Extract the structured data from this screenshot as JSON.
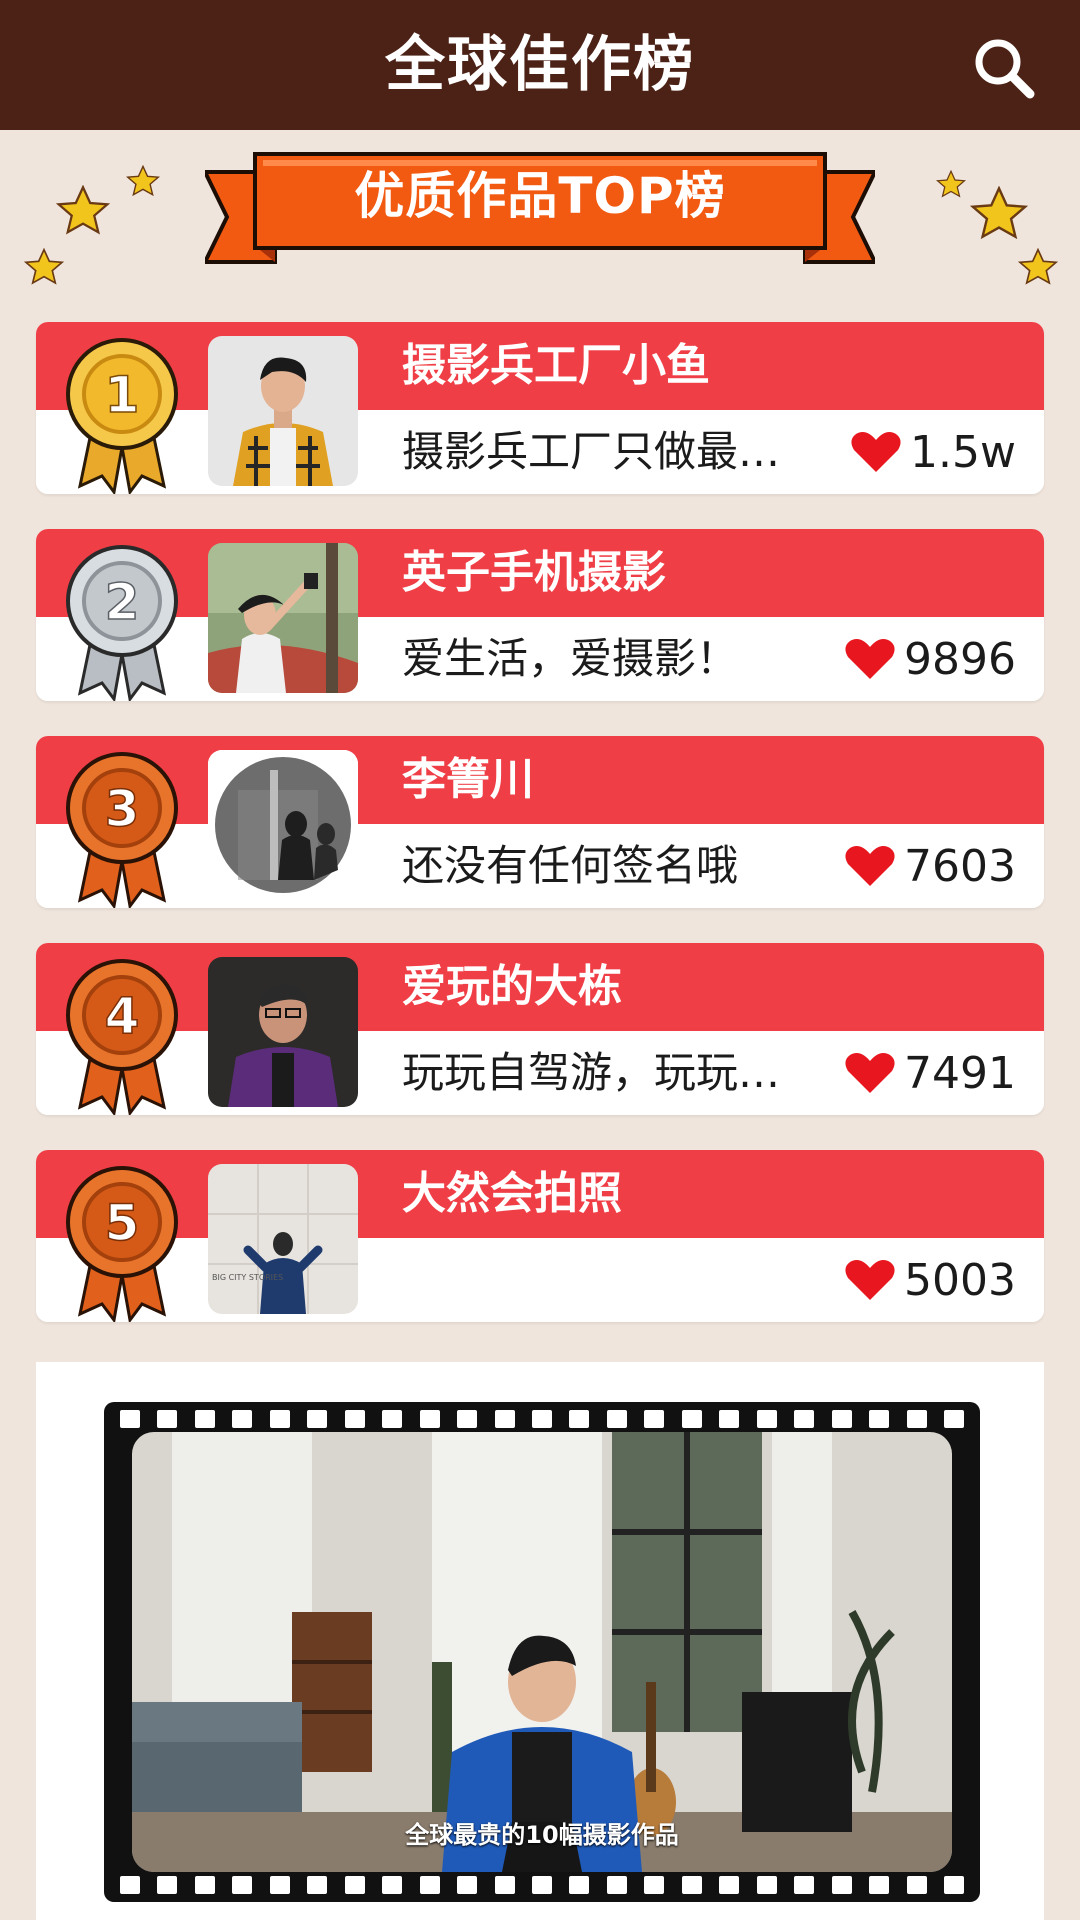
{
  "header": {
    "title": "全球佳作榜",
    "search_icon": "search-icon"
  },
  "banner": {
    "text": "优质作品TOP榜"
  },
  "ranking": [
    {
      "rank": "1",
      "name": "摄影兵工厂小鱼",
      "signature": "摄影兵工厂只做最…",
      "likes": "1.5w",
      "medal": "gold"
    },
    {
      "rank": "2",
      "name": "英子手机摄影",
      "signature": "爱生活，爱摄影！",
      "likes": "9896",
      "medal": "silver"
    },
    {
      "rank": "3",
      "name": "李箐川",
      "signature": "还没有任何签名哦",
      "likes": "7603",
      "medal": "bronze"
    },
    {
      "rank": "4",
      "name": "爱玩的大栋",
      "signature": "玩玩自驾游，玩玩…",
      "likes": "7491",
      "medal": "bronze"
    },
    {
      "rank": "5",
      "name": "大然会拍照",
      "signature": "",
      "likes": "5003",
      "medal": "bronze"
    }
  ],
  "avatar5_watermark": "BIG CITY STORIES",
  "video": {
    "caption": "全球最贵的10幅摄影作品"
  },
  "colors": {
    "topbar": "#4c2216",
    "background": "#efe5dc",
    "card_red": "#ef3e46",
    "banner_orange": "#f25a12",
    "heart": "#e8161e"
  }
}
